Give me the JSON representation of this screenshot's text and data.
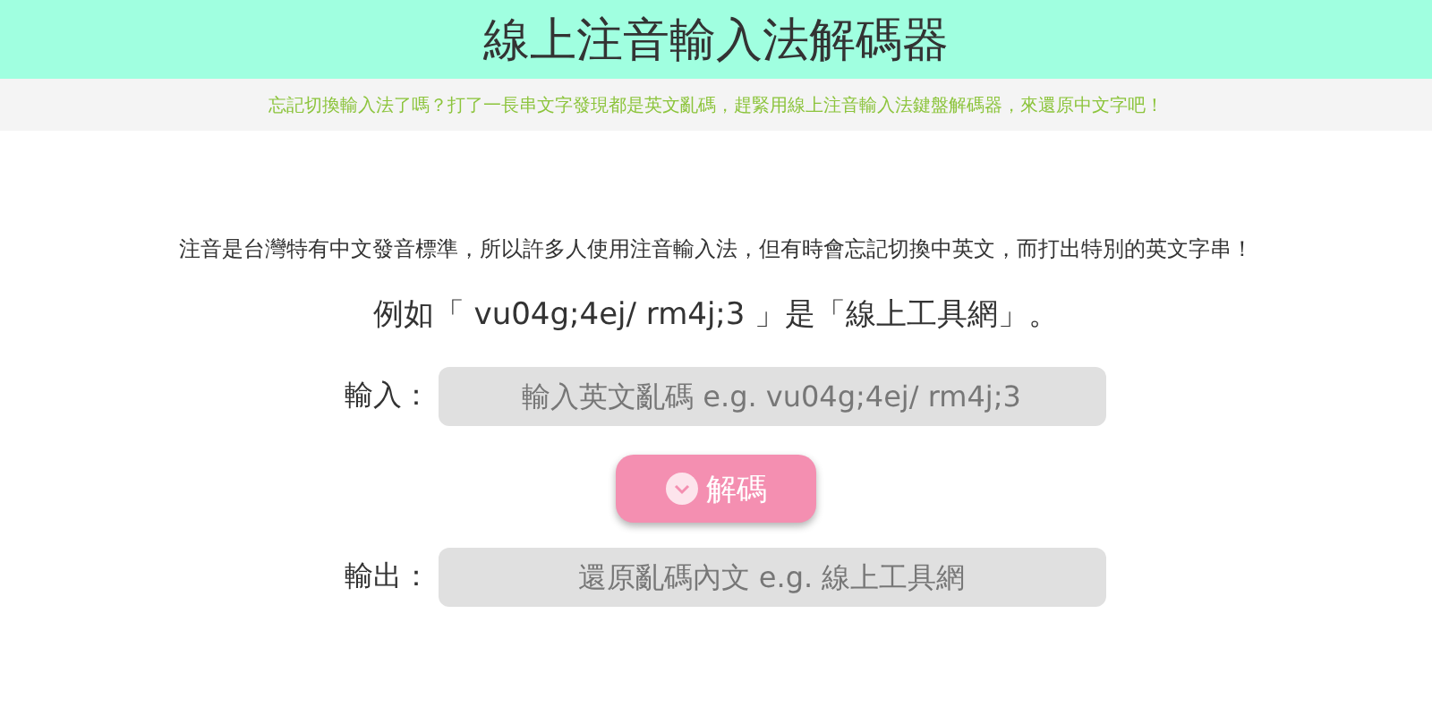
{
  "header": {
    "title": "線上注音輸入法解碼器"
  },
  "subtitle": "忘記切換輸入法了嗎？打了一長串文字發現都是英文亂碼，趕緊用線上注音輸入法鍵盤解碼器，來還原中文字吧！",
  "intro": "注音是台灣特有中文發音標準，所以許多人使用注音輸入法，但有時會忘記切換中英文，而打出特別的英文字串！",
  "example": "例如「 vu04g;4ej/ rm4j;3 」是「線上工具網」。",
  "input": {
    "label": "輸入：",
    "placeholder": "輸入英文亂碼 e.g. vu04g;4ej/ rm4j;3"
  },
  "decode_button": "解碼",
  "output": {
    "label": "輸出：",
    "placeholder": "還原亂碼內文 e.g. 線上工具網"
  }
}
